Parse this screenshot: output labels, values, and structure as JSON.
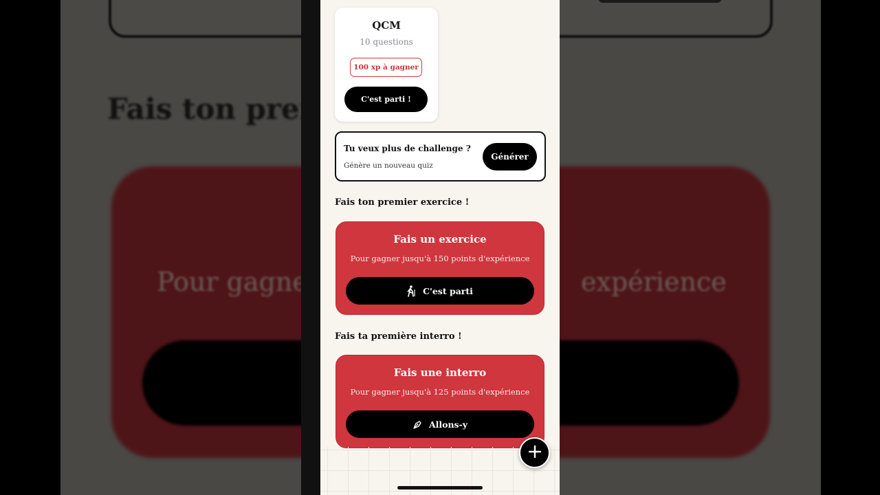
{
  "background": {
    "heading_fragment": "Fais ton prem",
    "text_left_fragment": "Pour gagne",
    "text_right_fragment": "expérience"
  },
  "qcm": {
    "title": "QCM",
    "subtitle": "10 questions",
    "xp_badge": "100 xp à gagner",
    "button": "C'est parti !"
  },
  "challenge": {
    "title": "Tu veux plus de challenge ?",
    "subtitle": "Génère un nouveau quiz",
    "button": "Générer"
  },
  "exercise_section": {
    "heading": "Fais ton premier exercice !",
    "card_title": "Fais un exercice",
    "card_subtitle": "Pour gagner jusqu'à 150 points d'expérience",
    "button": "C'est parti",
    "button_icon": "hiker-icon"
  },
  "interro_section": {
    "heading": "Fais ta première interro !",
    "card_title": "Fais une interro",
    "card_subtitle": "Pour gagner jusqu'à 125 points d'expérience",
    "button": "Allons-y",
    "button_icon": "pen-nib-icon"
  },
  "fab_icon": "plus-icon",
  "colors": {
    "accent_red": "#cf363d",
    "background": "#f8f5ef",
    "button_black": "#000000"
  }
}
